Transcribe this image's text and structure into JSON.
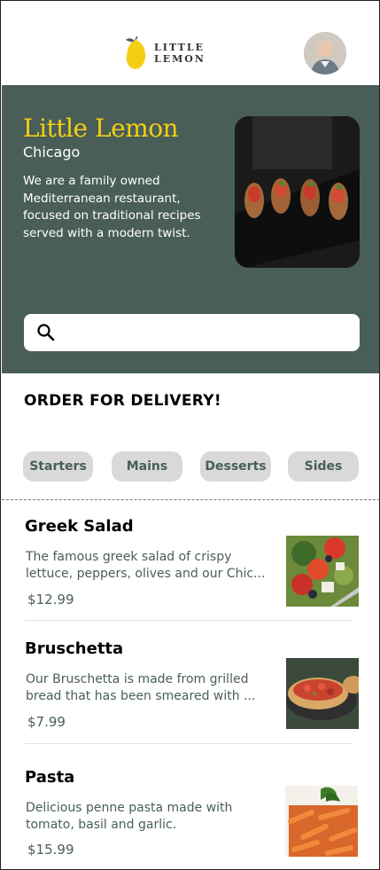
{
  "header": {
    "logo_text": "LITTLE LEMON",
    "avatar_icon": "profile-avatar"
  },
  "hero": {
    "title": "Little Lemon",
    "city": "Chicago",
    "description": "We are a family owned Mediterranean restaurant, focused on traditional recipes served with a modern twist.",
    "search_placeholder": ""
  },
  "order": {
    "title": "ORDER FOR DELIVERY!",
    "categories": [
      "Starters",
      "Mains",
      "Desserts",
      "Sides"
    ]
  },
  "menu": [
    {
      "title": "Greek Salad",
      "description": "The famous greek salad of crispy lettuce, peppers, olives and our Chic...",
      "price": "$12.99"
    },
    {
      "title": "Bruschetta",
      "description": "Our Bruschetta is made from grilled bread that has been smeared with ...",
      "price": "$7.99"
    },
    {
      "title": "Pasta",
      "description": "Delicious penne pasta made with tomato, basil and garlic.",
      "price": "$15.99"
    }
  ],
  "colors": {
    "primary_green": "#495e57",
    "primary_yellow": "#f4ce14",
    "chip_bg": "#d9d9d9"
  }
}
